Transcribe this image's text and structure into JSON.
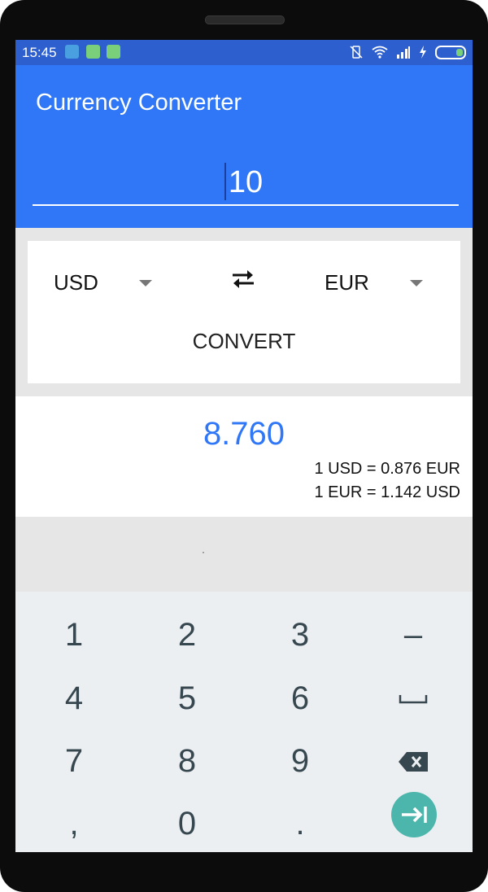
{
  "status_bar": {
    "time": "15:45"
  },
  "app_bar": {
    "title": "Currency Converter"
  },
  "amount": {
    "value": "10"
  },
  "converter": {
    "from_currency": "USD",
    "to_currency": "EUR",
    "convert_label": "CONVERT"
  },
  "result": {
    "value": "8.760",
    "rate_forward": "1 USD = 0.876 EUR",
    "rate_reverse": "1 EUR = 1.142 USD"
  },
  "keyboard": {
    "keys": [
      "1",
      "2",
      "3",
      "–",
      "4",
      "5",
      "6",
      "7",
      "8",
      "9",
      ",",
      "0",
      "."
    ]
  },
  "colors": {
    "primary": "#2f77f6",
    "status_bar": "#2d5fcf",
    "accent_teal": "#4db6ac"
  }
}
